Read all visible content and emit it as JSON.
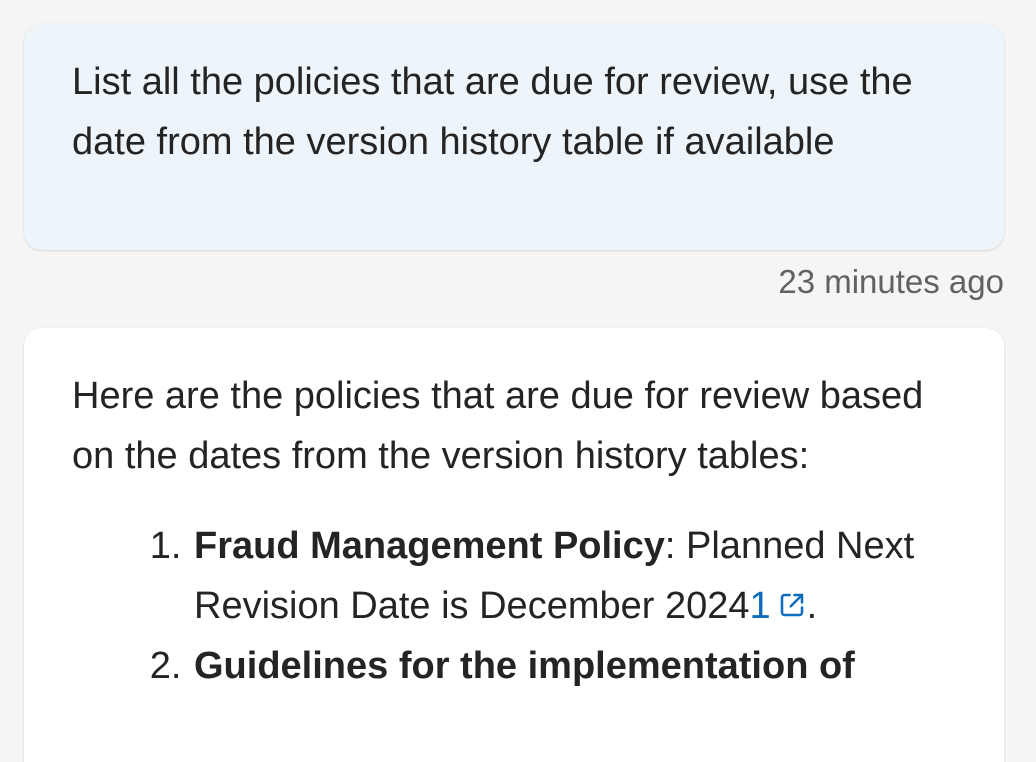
{
  "user_message": {
    "text": "List all the policies that are due for review, use the date from the version history table if available",
    "timestamp": "23 minutes ago"
  },
  "bot_message": {
    "intro": "Here are the policies that are due for review based on the dates from the version history tables:",
    "items": [
      {
        "number": "1",
        "name": "Fraud Management Policy",
        "separator": ": ",
        "detail": "Planned Next Revision Date is December 2024",
        "citation": "1",
        "trailing": "."
      },
      {
        "number": "2",
        "name": "Guidelines for the implementation of",
        "separator": "",
        "detail": "",
        "citation": "",
        "trailing": ""
      }
    ],
    "link_icon": "external-link-icon"
  },
  "colors": {
    "user_bubble_bg": "#eef5fa",
    "bot_bubble_bg": "#ffffff",
    "page_bg": "#f5f5f5",
    "citation": "#0f6cbd",
    "text": "#242424",
    "timestamp": "#616161"
  }
}
